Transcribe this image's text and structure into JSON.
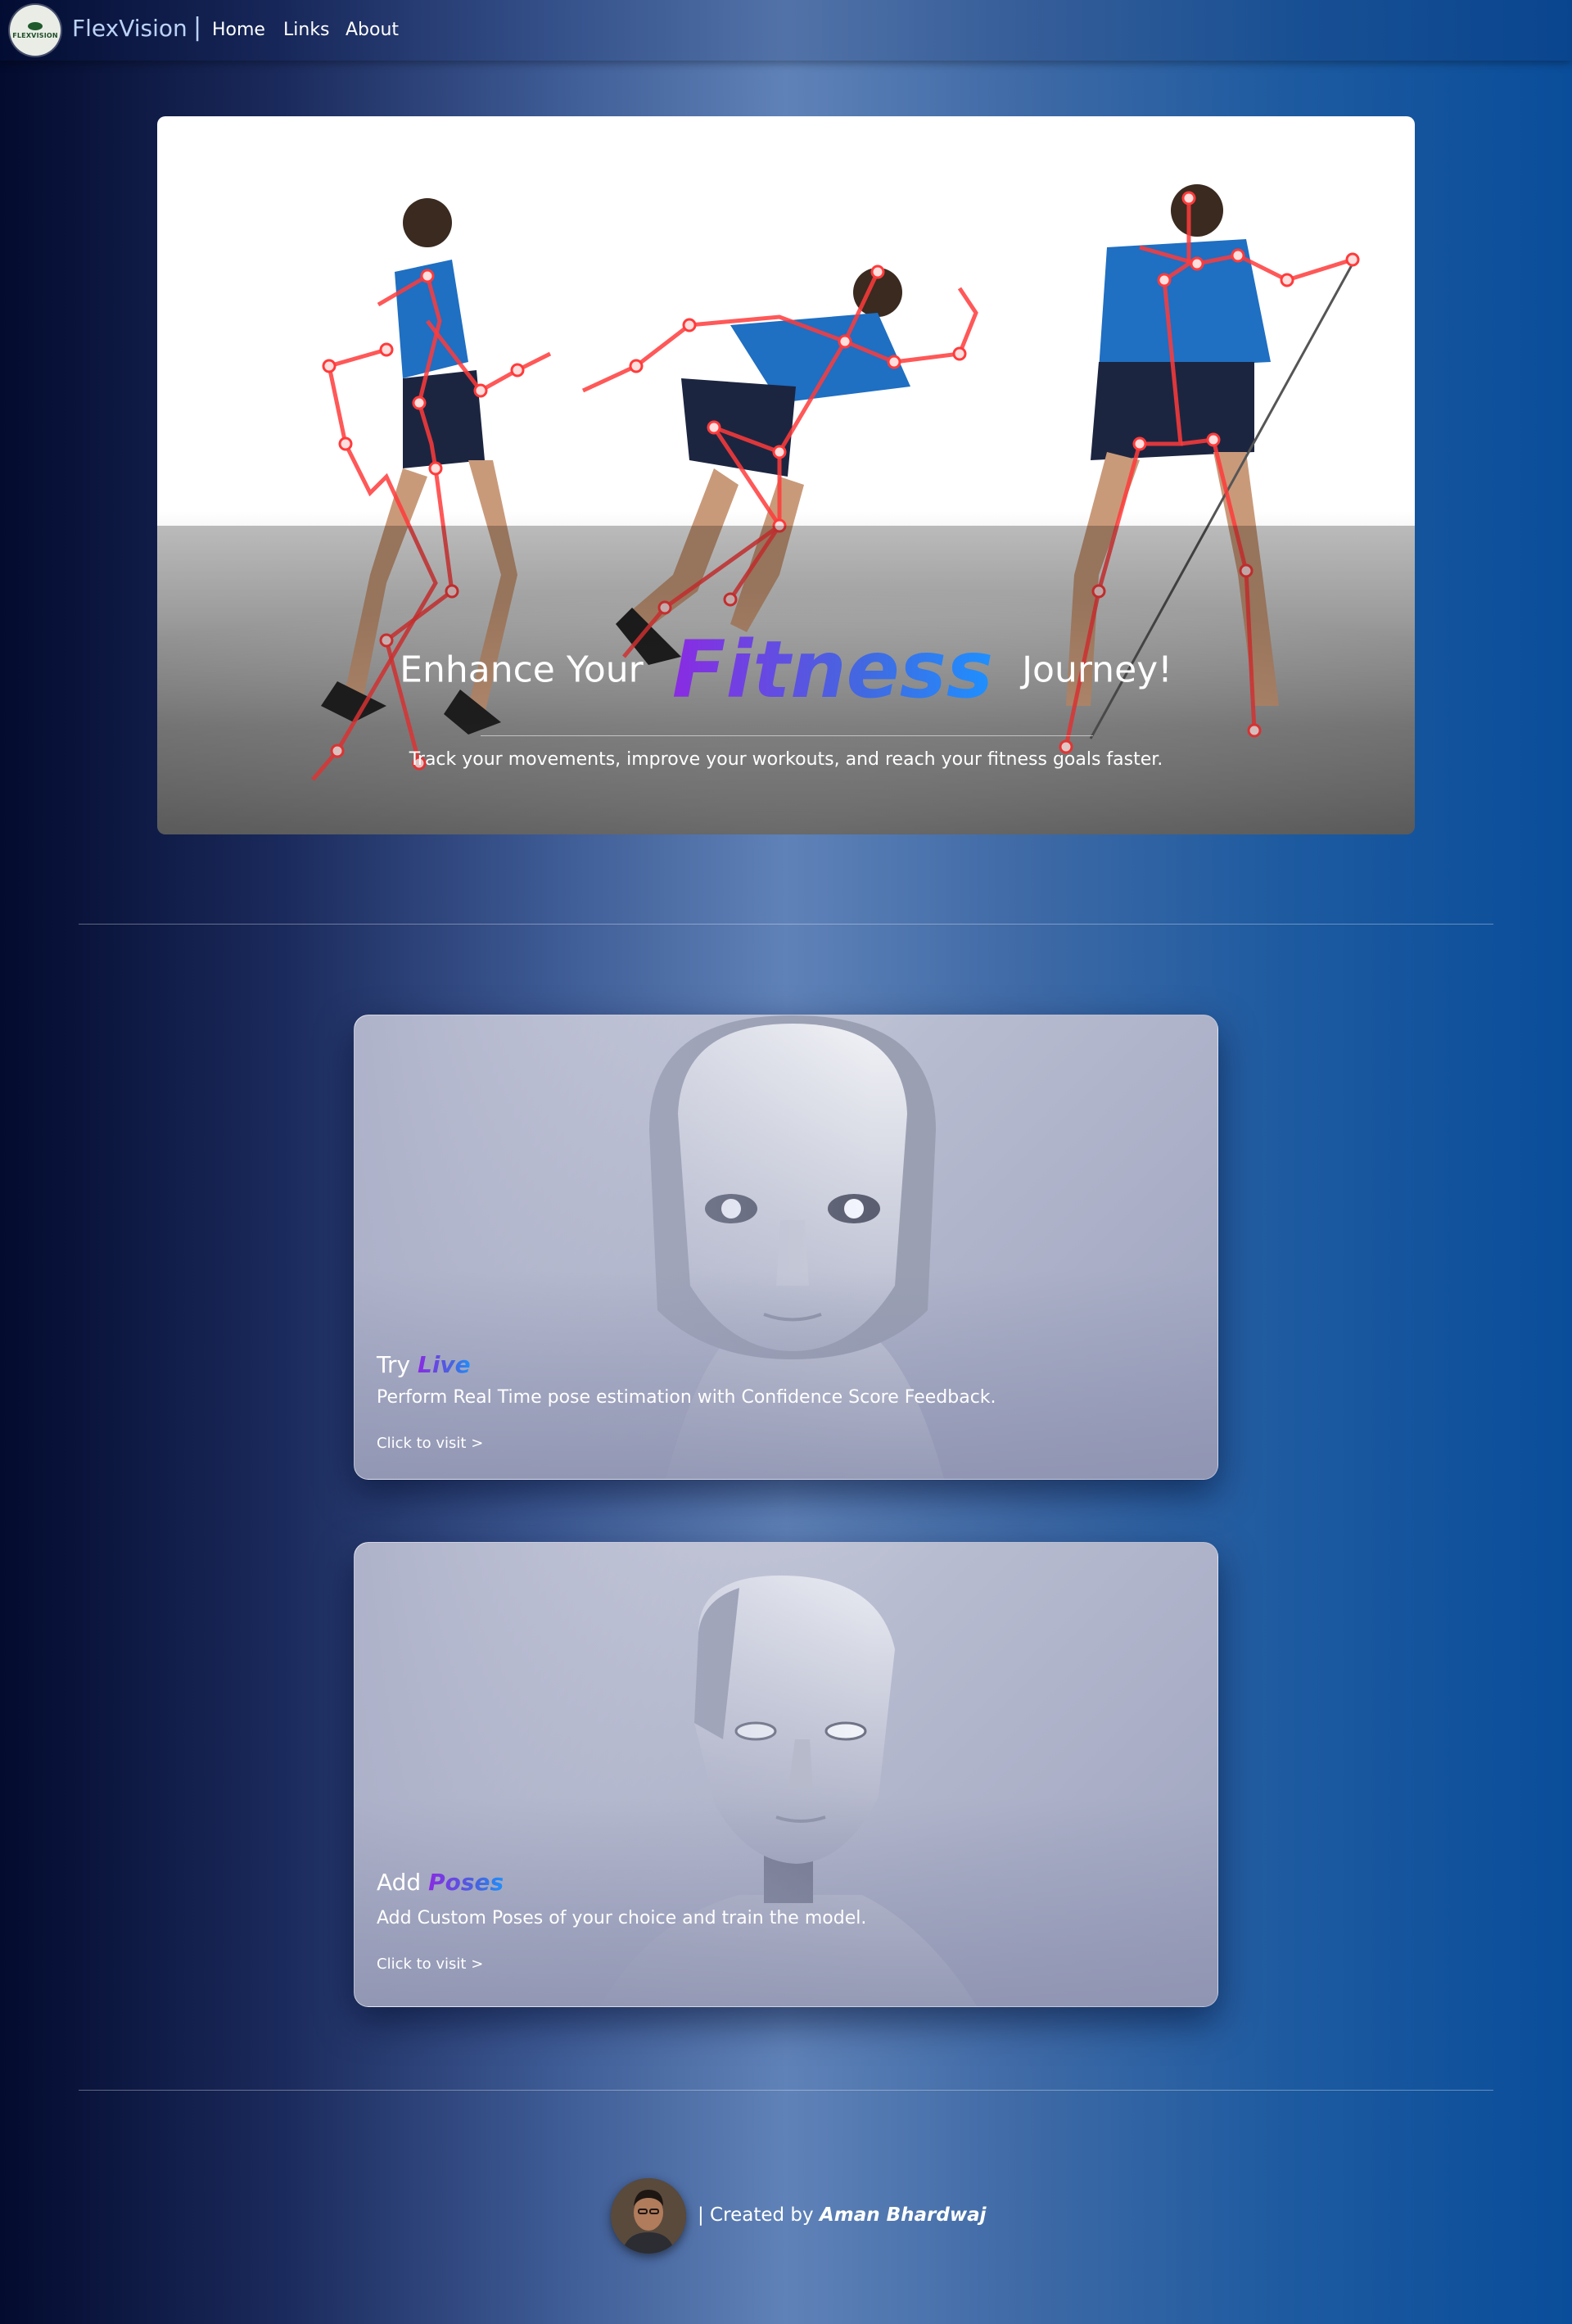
{
  "navbar": {
    "logo_text": "FLEXVISION",
    "brand": "FlexVision",
    "separator": "|",
    "links": [
      "Home",
      "Links",
      "About"
    ]
  },
  "hero": {
    "title_before": "Enhance Your",
    "title_highlight": "Fitness",
    "title_after": "Journey!",
    "subtitle": "Track your movements, improve your workouts, and reach your fitness goals faster."
  },
  "cards": [
    {
      "title_prefix": "Try",
      "title_accent": "Live",
      "description": "Perform Real Time pose estimation with Confidence Score Feedback.",
      "cta": "Click to visit >"
    },
    {
      "title_prefix": "Add",
      "title_accent": "Poses",
      "description": "Add Custom Poses of your choice and train the model.",
      "cta": "Click to visit >"
    }
  ],
  "footer": {
    "prefix": "| Created by",
    "author": "Aman Bhardwaj"
  },
  "colors": {
    "accent_gradient_start": "#8a2be2",
    "accent_gradient_end": "#1e90ff",
    "skeleton": "#ff3b3b",
    "nav_brand": "#bcd3f7"
  },
  "icons": {
    "logo": "flexvision-eye-logo",
    "avatar": "author-avatar"
  }
}
